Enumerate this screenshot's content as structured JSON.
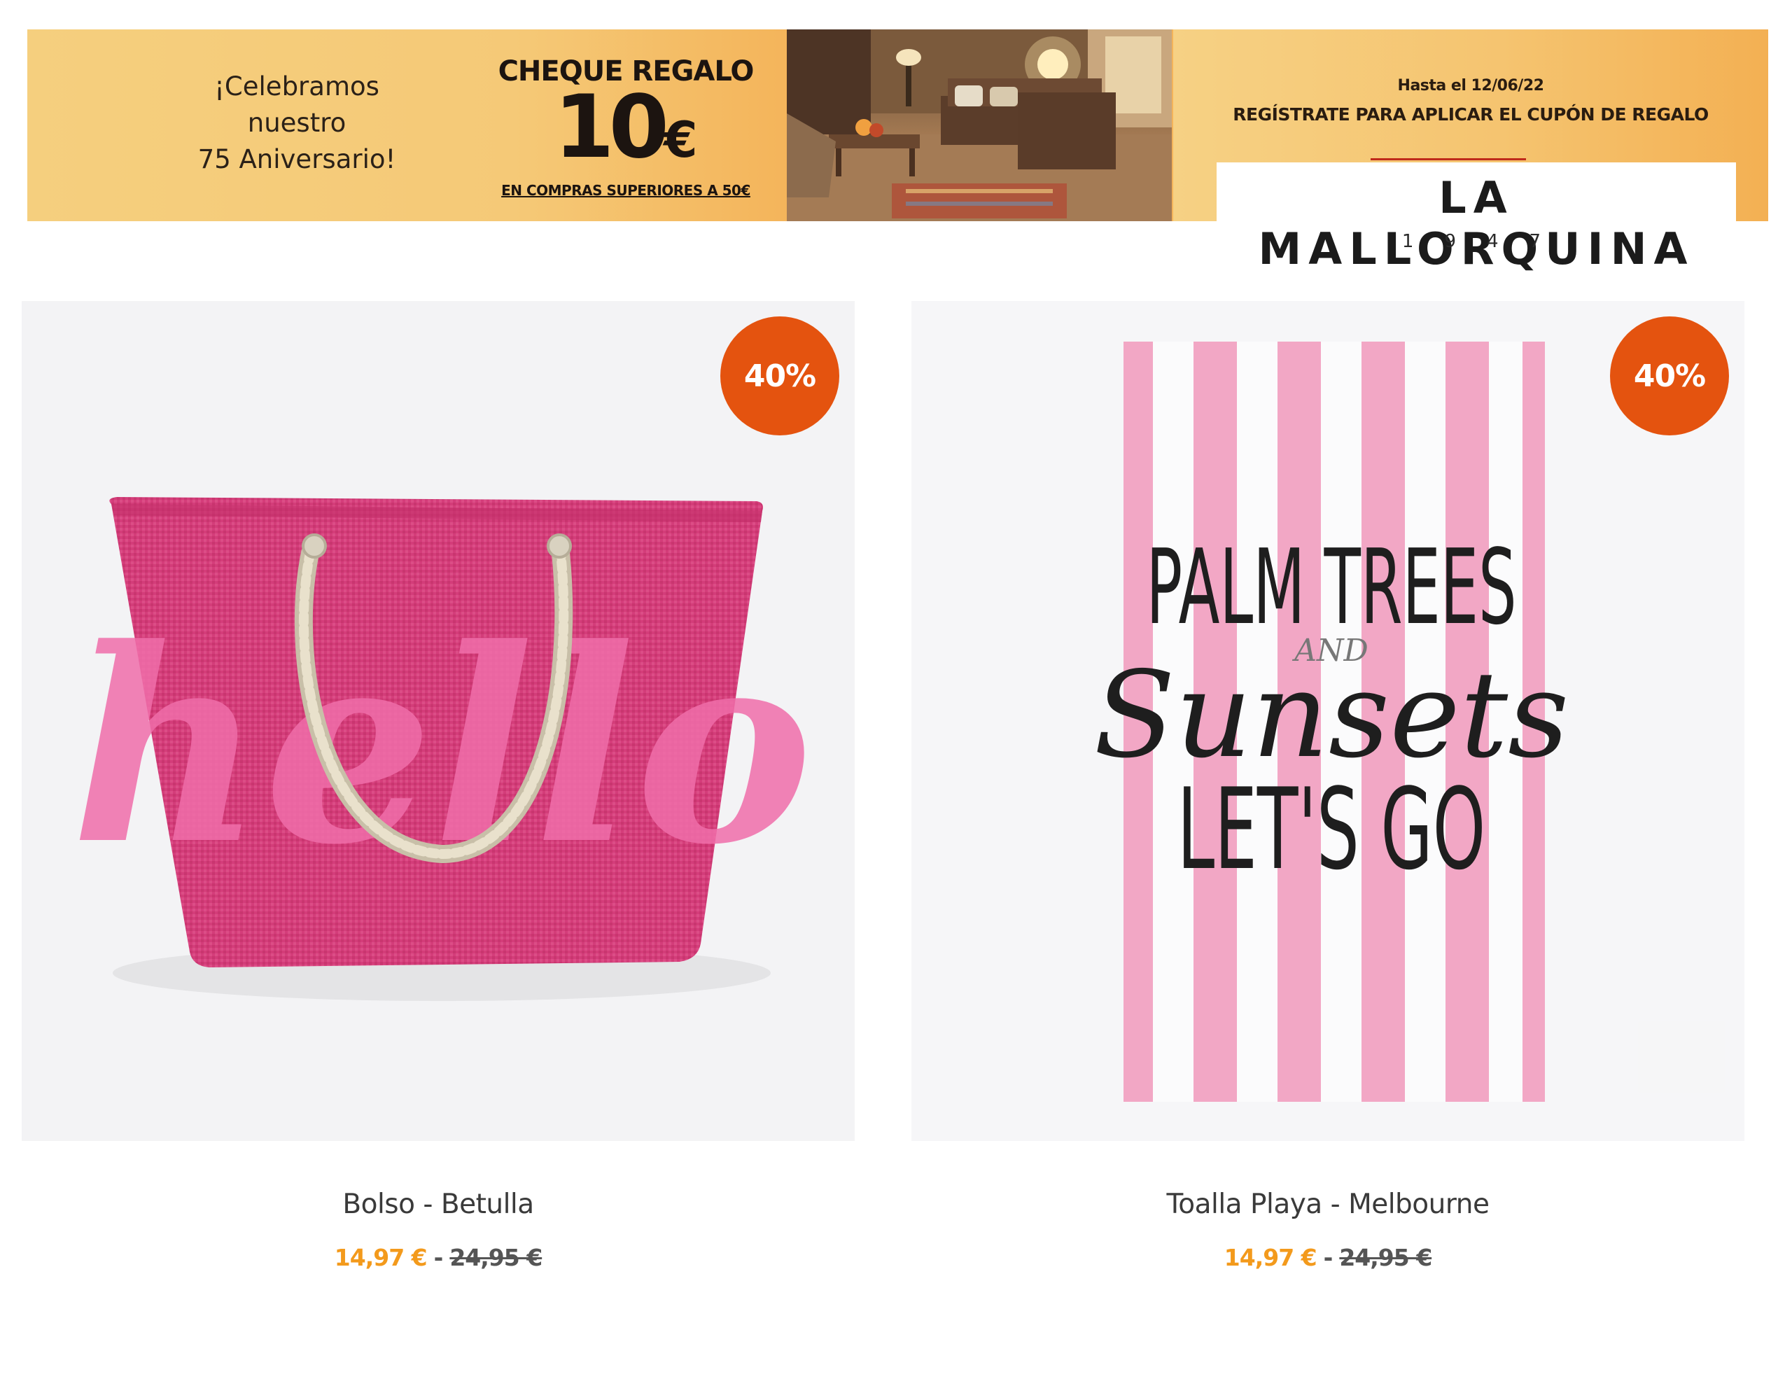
{
  "banner": {
    "celebrate_lines": [
      "¡Celebramos",
      "nuestro",
      "75 Aniversario!"
    ],
    "cheque_title": "CHEQUE REGALO",
    "cheque_amount": "10",
    "cheque_currency": "€",
    "cheque_note": "EN COMPRAS SUPERIORES A 50€",
    "date_text": "Hasta el 12/06/22",
    "register_text": "REGÍSTRATE PARA APLICAR EL CUPÓN DE REGALO",
    "brand_name": "LA MALLORQUINA",
    "brand_year": "1947"
  },
  "products": [
    {
      "name": "Bolso - Betulla",
      "discount": "40%",
      "price_current": "14,97 €",
      "separator": "-",
      "price_old": "24,95 €",
      "image": "pink-hello-beach-bag"
    },
    {
      "name": "Toalla Playa - Melbourne",
      "discount": "40%",
      "price_current": "14,97 €",
      "separator": "-",
      "price_old": "24,95 €",
      "image": "striped-beach-towel",
      "print_text": [
        "PALM TREES",
        "AND",
        "Sunsets",
        "LET'S GO"
      ]
    }
  ],
  "colors": {
    "discount_badge": "#e4530f",
    "price_current": "#f39a1c",
    "bag_pink": "#d43d7a",
    "towel_stripe": "#f2a7c5"
  }
}
